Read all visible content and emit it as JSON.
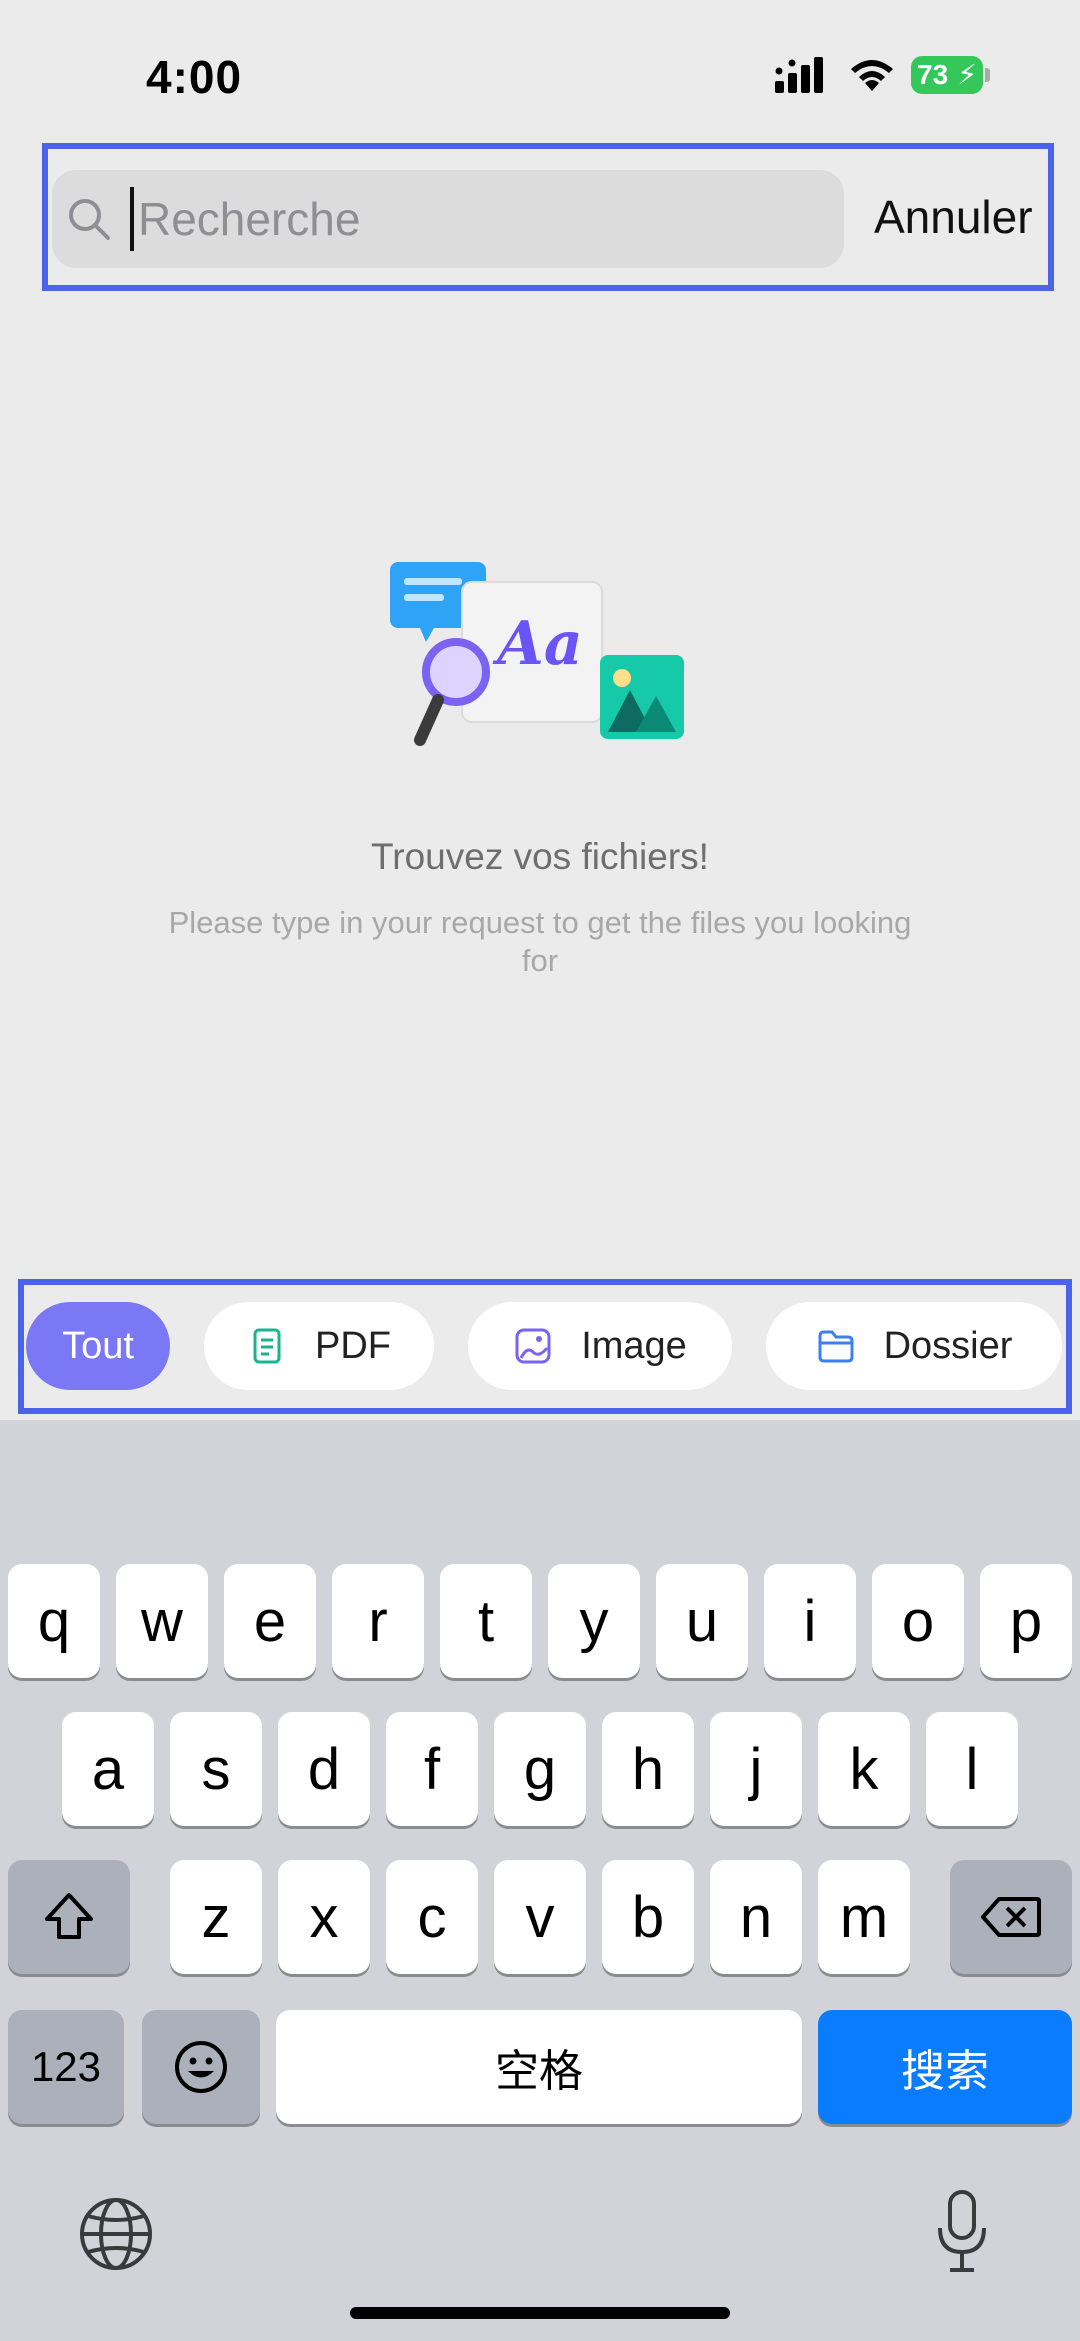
{
  "status_bar": {
    "time": "4:00",
    "battery": "73"
  },
  "search": {
    "placeholder": "Recherche",
    "value": "",
    "cancel_label": "Annuler"
  },
  "empty_state": {
    "title": "Trouvez vos fichiers!",
    "subtitle": "Please type in your request to get the files you looking for",
    "illustration_text": "Aa"
  },
  "filters": [
    {
      "label": "Tout",
      "icon": "",
      "active": true
    },
    {
      "label": "PDF",
      "icon": "pdf-document-icon",
      "active": false
    },
    {
      "label": "Image",
      "icon": "image-icon",
      "active": false
    },
    {
      "label": "Dossier",
      "icon": "folder-icon",
      "active": false
    }
  ],
  "keyboard": {
    "row1": [
      "q",
      "w",
      "e",
      "r",
      "t",
      "y",
      "u",
      "i",
      "o",
      "p"
    ],
    "row2": [
      "a",
      "s",
      "d",
      "f",
      "g",
      "h",
      "j",
      "k",
      "l"
    ],
    "row3": [
      "z",
      "x",
      "c",
      "v",
      "b",
      "n",
      "m"
    ],
    "numbers_label": "123",
    "space_label": "空格",
    "search_label": "搜索"
  },
  "colors": {
    "accent": "#7b78f5",
    "highlight_border": "#4b63e8",
    "keyboard_action": "#0a7cff",
    "battery": "#34c759"
  }
}
